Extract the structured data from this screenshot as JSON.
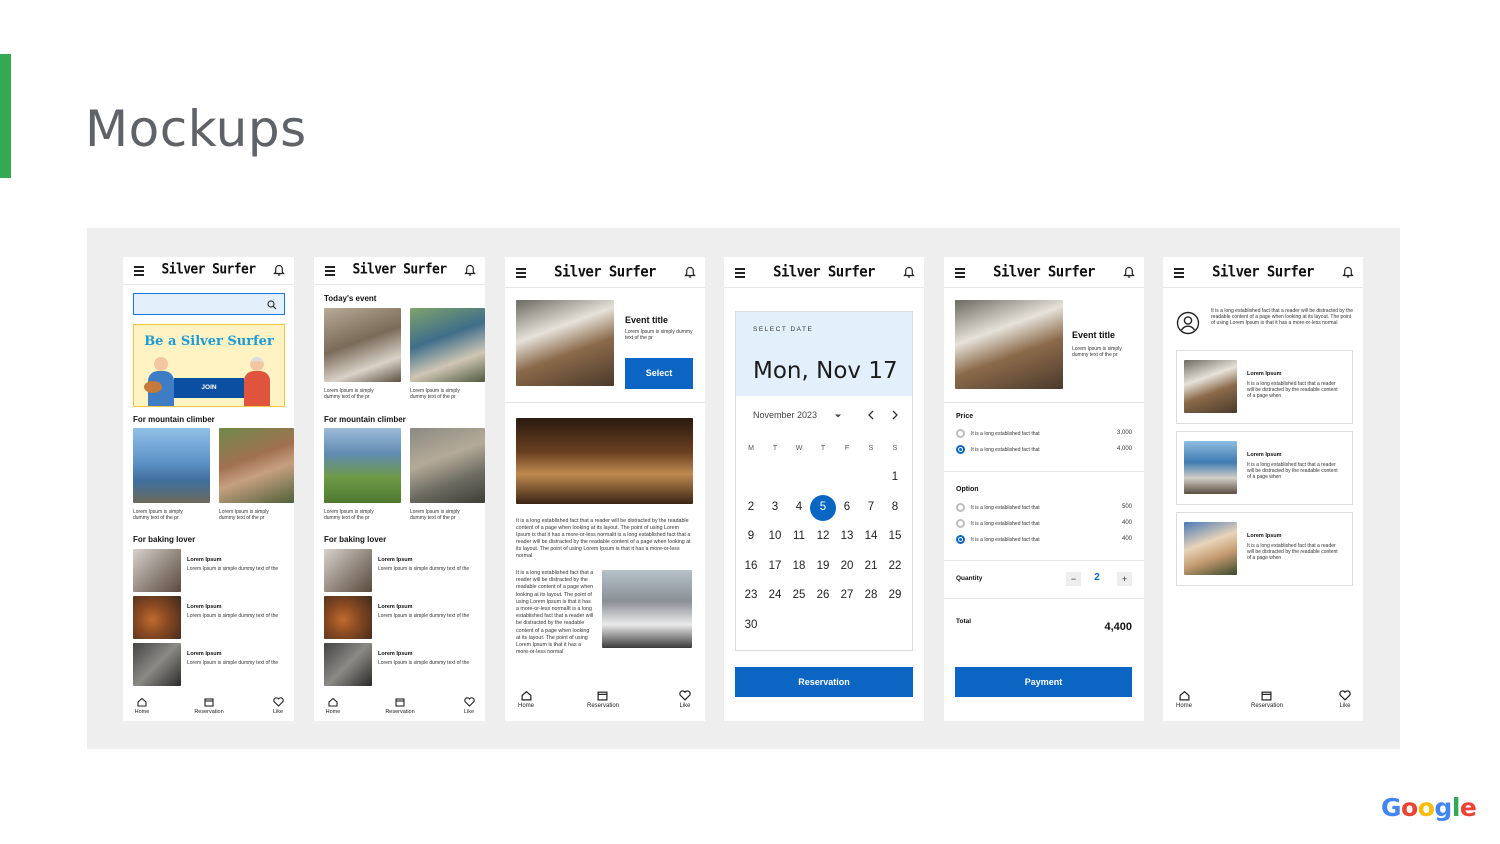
{
  "slide": {
    "title": "Mockups",
    "logo": "Google"
  },
  "colors": {
    "accent": "#34a853",
    "primary": "#0a66c2",
    "panel": "#eeeeee",
    "title": "#5f6368"
  },
  "app": {
    "brand": "Silver Surfer",
    "nav": {
      "home": "Home",
      "reservation": "Reservation",
      "like": "Like"
    }
  },
  "screen1": {
    "banner_title": "Be a Silver Surfer",
    "join": "JOIN",
    "section_mountain": "For mountain climber",
    "caption": "Lorem Ipsum is simply dummy text of the pr",
    "section_baking": "For baking lover",
    "item_title": "Lorem Ipsum",
    "item_text": "Lorem Ipsum is simple dummy text of the"
  },
  "screen2": {
    "todays_event": "Today's event",
    "caption": "Lorem Ipsum is simply dummy text of the pr",
    "section_mountain": "For mountain climber",
    "section_baking": "For baking lover",
    "item_title": "Lorem Ipsum",
    "item_text": "Lorem Ipsum is simple dummy text of the"
  },
  "screen3": {
    "event_title": "Event title",
    "event_desc": "Lorem Ipsum is simply dummy text of the pr",
    "select": "Select",
    "para1": "It is a long established fact that a reader will be distracted by the readable content of a page when looking at its layout. The point of using Lorem Ipsum is that it has a more-or-less normalit is a long established fact that a reader will be distracted by the readable content of a page when looking at its layout. The point of using Lorem Ipsum is that it has a more-or-less normal",
    "para2": "It is a long established fact that a reader will be distracted by the readable content of a page when looking at its layout. The point of using Lorem Ipsum is that it has a more-or-less normalIt is a long established fact that a reader will be distracted by the readable content of a page when looking at its layout. The point of using Lorem Ipsum is that it has a more-or-less normal"
  },
  "screen4": {
    "select_date": "SELECT DATE",
    "date": "Mon, Nov 17",
    "month": "November 2023",
    "dow": [
      "M",
      "T",
      "W",
      "T",
      "F",
      "S",
      "S"
    ],
    "weeks": [
      [
        "",
        "",
        "",
        "",
        "",
        "",
        "1"
      ],
      [
        "2",
        "3",
        "4",
        "5",
        "6",
        "7",
        "8"
      ],
      [
        "9",
        "10",
        "11",
        "12",
        "13",
        "14",
        "15"
      ],
      [
        "16",
        "17",
        "18",
        "19",
        "20",
        "21",
        "22"
      ],
      [
        "23",
        "24",
        "25",
        "26",
        "27",
        "28",
        "29"
      ],
      [
        "30",
        "",
        "",
        "",
        "",
        "",
        ""
      ]
    ],
    "selected_day": "5",
    "reservation": "Reservation"
  },
  "screen5": {
    "event_title": "Event title",
    "event_desc": "Lorem Ipsum is simply dummy text of the pr",
    "price_label": "Price",
    "price_items": [
      {
        "text": "It is a long established fact that",
        "value": "3,000",
        "selected": false
      },
      {
        "text": "It is a long established fact that",
        "value": "4,000",
        "selected": true
      }
    ],
    "option_label": "Option",
    "option_items": [
      {
        "text": "It is a long established fact that",
        "value": "500",
        "selected": false
      },
      {
        "text": "It is a long established fact that",
        "value": "400",
        "selected": false
      },
      {
        "text": "It is a long established fact that",
        "value": "400",
        "selected": true
      }
    ],
    "quantity_label": "Quantity",
    "quantity": "2",
    "minus": "−",
    "plus": "+",
    "total_label": "Total",
    "total": "4,400",
    "payment": "Payment"
  },
  "screen6": {
    "intro": "It is a long established fact that a reader will be distracted by the readable content of a page when looking at its layout. The point of using Lorem Ipsum is that it has a more-or-less normal",
    "cards": [
      {
        "title": "Lorem Ipsum",
        "text": "It is a long established fact that a reader will be distracted by the readable content of a page when"
      },
      {
        "title": "Lorem Ipsum",
        "text": "It is a long established fact that a reader will be distracted by the readable content of a page when"
      },
      {
        "title": "Lorem Ipsum",
        "text": "It is a long established fact that a reader will be distracted by the readable content of a page when"
      }
    ]
  }
}
